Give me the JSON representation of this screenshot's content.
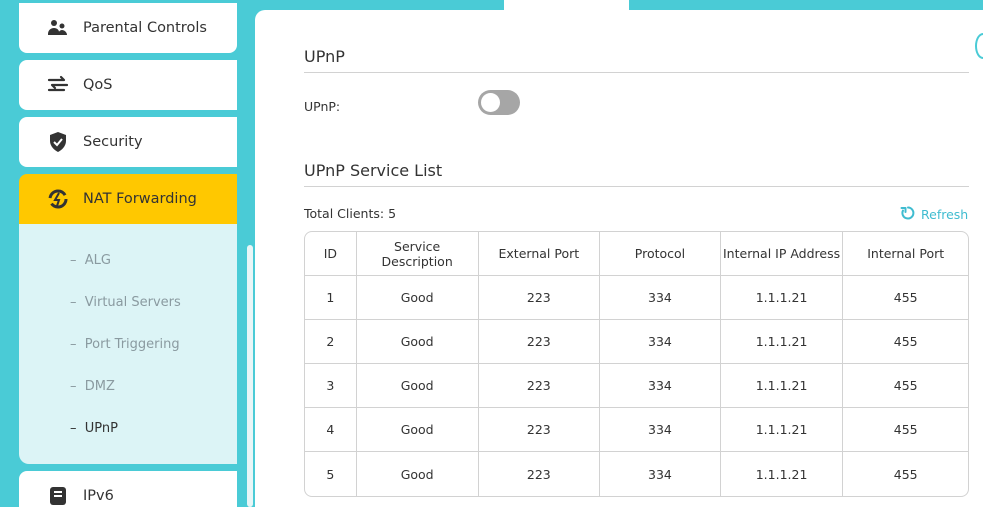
{
  "sidebar": {
    "items": [
      {
        "label": "Parental Controls",
        "icon": "parental-controls-icon"
      },
      {
        "label": "QoS",
        "icon": "qos-icon"
      },
      {
        "label": "Security",
        "icon": "shield-icon"
      },
      {
        "label": "NAT Forwarding",
        "icon": "nat-forwarding-icon"
      },
      {
        "label": "IPv6",
        "icon": "ipv6-icon"
      }
    ],
    "submenu": [
      {
        "label": "ALG",
        "prefix": "–"
      },
      {
        "label": "Virtual Servers",
        "prefix": "–"
      },
      {
        "label": "Port Triggering",
        "prefix": "–"
      },
      {
        "label": "DMZ",
        "prefix": "–"
      },
      {
        "label": "UPnP",
        "prefix": "–"
      }
    ]
  },
  "upnp": {
    "title": "UPnP",
    "field_label": "UPnP:",
    "enabled": false
  },
  "service_list": {
    "title": "UPnP Service List",
    "total_label": "Total Clients:",
    "total_value": "5",
    "refresh_label": "Refresh",
    "columns": [
      "ID",
      "Service Description",
      "External Port",
      "Protocol",
      "Internal IP Address",
      "Internal Port"
    ],
    "rows": [
      [
        "1",
        "Good",
        "223",
        "334",
        "1.1.1.21",
        "455"
      ],
      [
        "2",
        "Good",
        "223",
        "334",
        "1.1.1.21",
        "455"
      ],
      [
        "3",
        "Good",
        "223",
        "334",
        "1.1.1.21",
        "455"
      ],
      [
        "4",
        "Good",
        "223",
        "334",
        "1.1.1.21",
        "455"
      ],
      [
        "5",
        "Good",
        "223",
        "334",
        "1.1.1.21",
        "455"
      ]
    ]
  },
  "colors": {
    "accent": "#4acbd6",
    "active": "#ffc800",
    "link": "#3fbcd0"
  }
}
